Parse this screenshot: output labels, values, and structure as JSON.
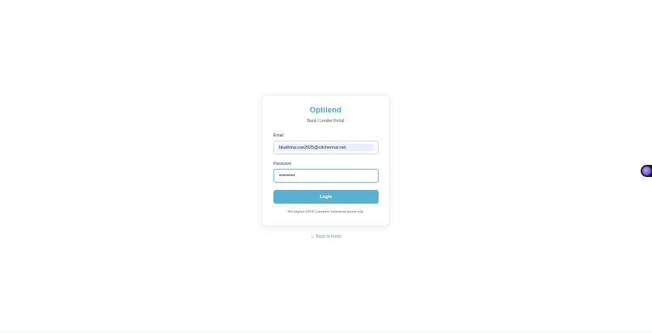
{
  "brand": {
    "title": "Optilend",
    "subtitle": "Bank / Lender Portal"
  },
  "form": {
    "email_label": "Email",
    "email_value": "bkathina.cse2025@citchennai.net",
    "password_label": "Password",
    "password_value": "••••••••",
    "login_label": "Login"
  },
  "notice": "RBI-Aligned. DPDP Compliant. Institutional access only.",
  "back_link": "← Back to home",
  "colors": {
    "accent": "#4aa8d0",
    "button": "#55b2d3"
  }
}
